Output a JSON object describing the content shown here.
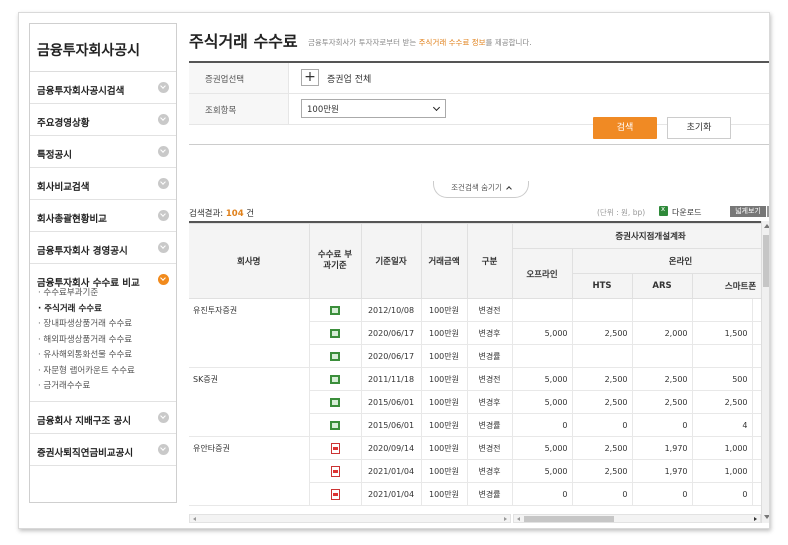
{
  "sidebar": {
    "title": "금융투자회사공시",
    "items": [
      {
        "label": "금융투자회사공시검색"
      },
      {
        "label": "주요경영상황"
      },
      {
        "label": "특정공시"
      },
      {
        "label": "회사비교검색"
      },
      {
        "label": "회사총괄현황비교"
      },
      {
        "label": "금융투자회사 경영공시"
      },
      {
        "label": "금융투자회사 수수료 비교"
      }
    ],
    "sub_items": [
      "수수료부과기준",
      "주식거래 수수료",
      "장내파생상품거래 수수료",
      "해외파생상품거래 수수료",
      "유사해외통화선물 수수료",
      "자문형 랩어카운트 수수료",
      "금거래수수료"
    ],
    "bottom_items": [
      {
        "label": "금융회사 지배구조 공시"
      },
      {
        "label": "증권사퇴직연금비교공시"
      }
    ]
  },
  "page": {
    "title": "주식거래 수수료",
    "desc_prefix": "금융투자회사가 투자자로부터 받는 ",
    "desc_highlight": "주식거래 수수료 정보",
    "desc_suffix": "를 제공합니다."
  },
  "search": {
    "broker_label": "증권업선택",
    "broker_button": "+",
    "broker_value": "증권업 전체",
    "item_label": "조회항목",
    "item_value": "100만원",
    "search_button": "검색",
    "reset_button": "초기화",
    "fold_label": "조건검색 숨기기"
  },
  "result": {
    "prefix": "검색결과: ",
    "count": "104",
    "suffix": " 건",
    "unit": "(단위 : 원, bp)",
    "download": "다운로드",
    "wide_view": "넓게보기"
  },
  "table": {
    "headers": {
      "company": "회사명",
      "basis": "수수료 부과기준",
      "date": "기준일자",
      "amount": "거래금액",
      "type": "구분",
      "account_group": "증권사지점개설계좌",
      "offline": "오프라인",
      "online": "온라인",
      "hts": "HTS",
      "ars": "ARS",
      "smartphone": "스마트폰"
    },
    "groups": [
      {
        "company": "유진투자증권",
        "rows": [
          {
            "icon": "xls",
            "date": "2012/10/08",
            "amount": "100만원",
            "type": "변경전",
            "offline": "",
            "hts": "",
            "ars": "",
            "smart": ""
          },
          {
            "icon": "xls",
            "date": "2020/06/17",
            "amount": "100만원",
            "type": "변경후",
            "offline": "5,000",
            "hts": "2,500",
            "ars": "2,000",
            "smart": "1,500"
          },
          {
            "icon": "xls",
            "date": "2020/06/17",
            "amount": "100만원",
            "type": "변경률",
            "offline": "",
            "hts": "",
            "ars": "",
            "smart": ""
          }
        ]
      },
      {
        "company": "SK증권",
        "rows": [
          {
            "icon": "xls",
            "date": "2011/11/18",
            "amount": "100만원",
            "type": "변경전",
            "offline": "5,000",
            "hts": "2,500",
            "ars": "2,500",
            "smart": "500"
          },
          {
            "icon": "xls",
            "date": "2015/06/01",
            "amount": "100만원",
            "type": "변경후",
            "offline": "5,000",
            "hts": "2,500",
            "ars": "2,500",
            "smart": "2,500"
          },
          {
            "icon": "xls",
            "date": "2015/06/01",
            "amount": "100만원",
            "type": "변경률",
            "offline": "0",
            "hts": "0",
            "ars": "0",
            "smart": "4"
          }
        ]
      },
      {
        "company": "유안타증권",
        "rows": [
          {
            "icon": "pdf",
            "date": "2020/09/14",
            "amount": "100만원",
            "type": "변경전",
            "offline": "5,000",
            "hts": "2,500",
            "ars": "1,970",
            "smart": "1,000"
          },
          {
            "icon": "pdf",
            "date": "2021/01/04",
            "amount": "100만원",
            "type": "변경후",
            "offline": "5,000",
            "hts": "2,500",
            "ars": "1,970",
            "smart": "1,000"
          },
          {
            "icon": "pdf",
            "date": "2021/01/04",
            "amount": "100만원",
            "type": "변경률",
            "offline": "0",
            "hts": "0",
            "ars": "0",
            "smart": "0"
          }
        ]
      }
    ]
  },
  "colors": {
    "accent": "#f08a24",
    "header_bg": "#f4f4f4"
  }
}
